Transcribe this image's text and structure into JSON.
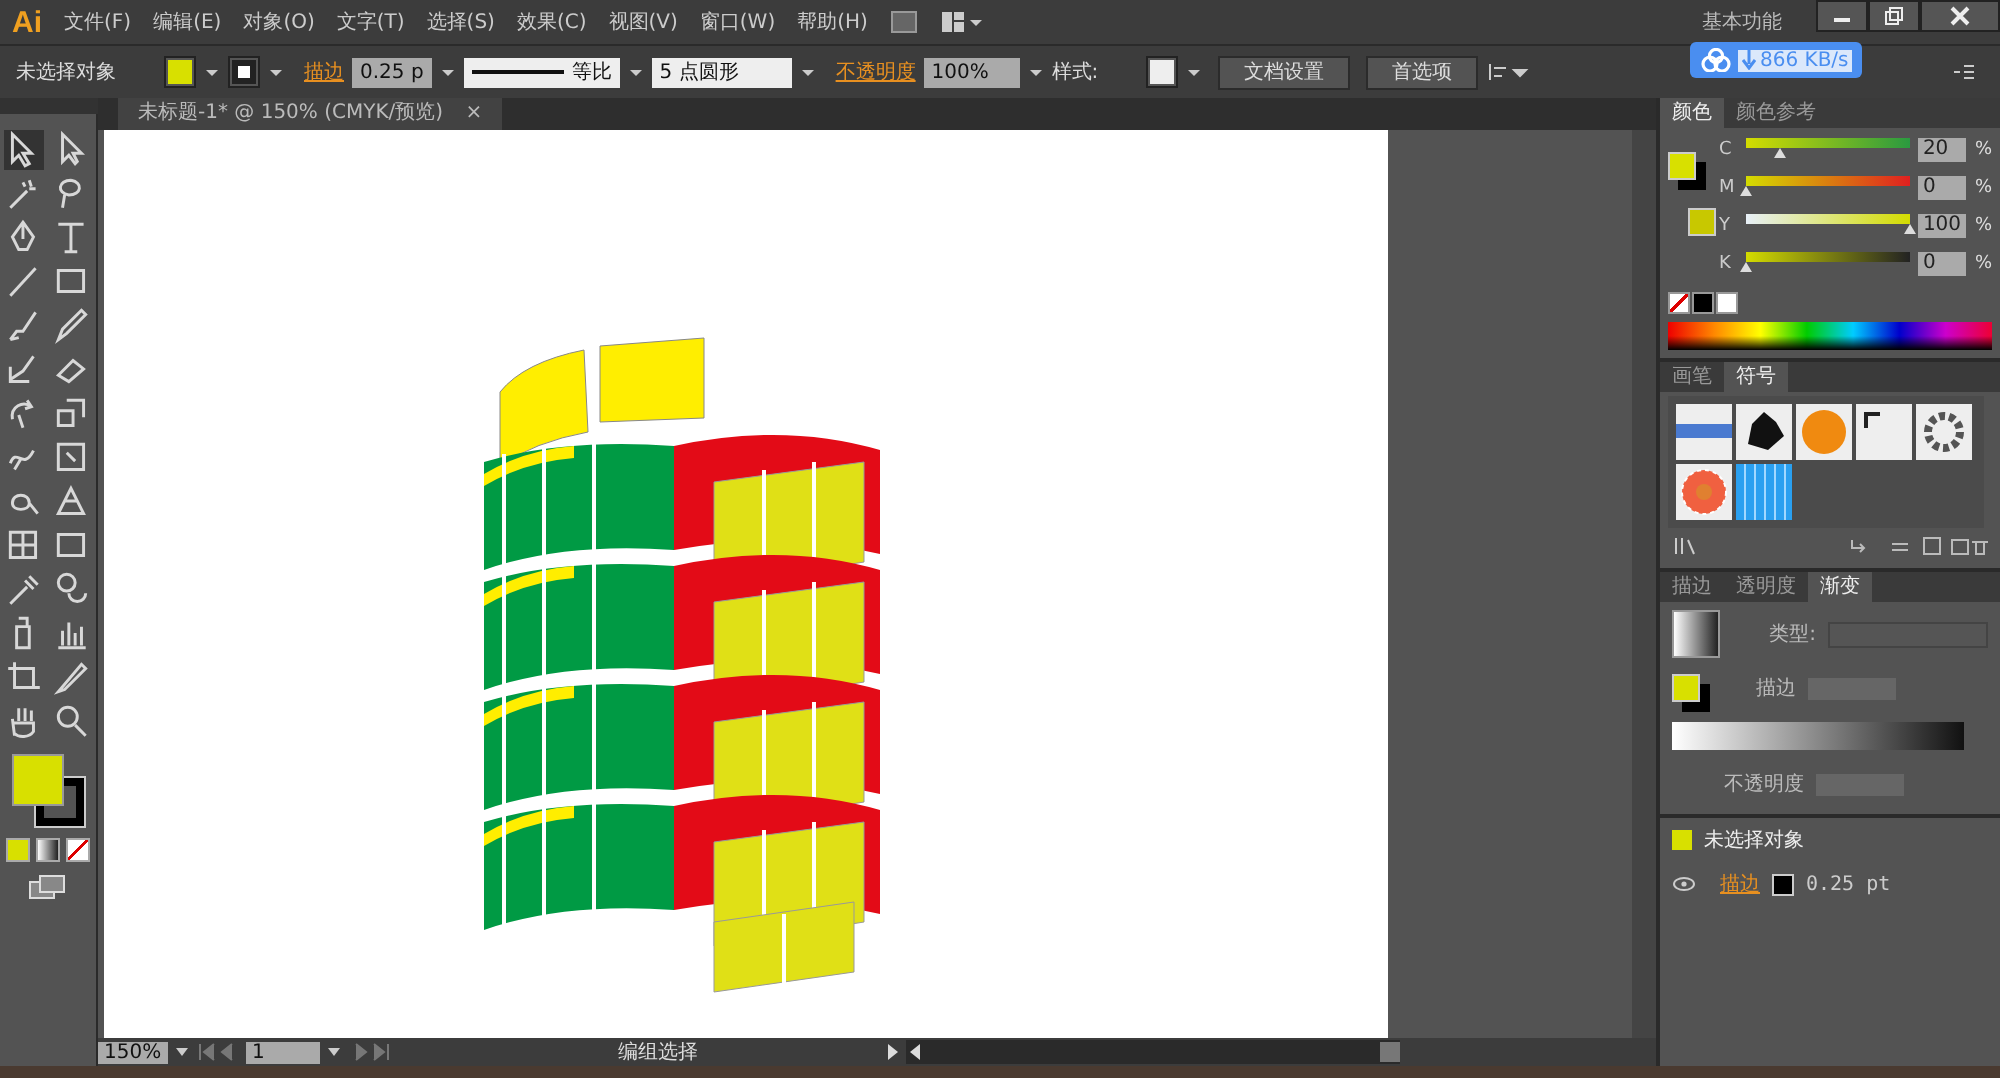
{
  "app_logo": "Ai",
  "menu": [
    "文件(F)",
    "编辑(E)",
    "对象(O)",
    "文字(T)",
    "选择(S)",
    "效果(C)",
    "视图(V)",
    "窗口(W)",
    "帮助(H)"
  ],
  "workspace": "基本功能",
  "transfer_speed": "866 KB/s",
  "control_bar": {
    "selection": "未选择对象",
    "stroke_label": "描边",
    "stroke_weight": "0.25 p",
    "stroke_profile": "等比",
    "brush": "5 点圆形",
    "opacity_label": "不透明度",
    "opacity": "100%",
    "style_label": "样式:",
    "doc_setup": "文档设置",
    "preferences": "首选项"
  },
  "document_tab": {
    "title": "未标题-1* @ 150% (CMYK/预览)",
    "close": "×"
  },
  "color_panel": {
    "tabs": [
      {
        "label": "颜色",
        "selected": true
      },
      {
        "label": "颜色参考",
        "selected": false
      }
    ],
    "sliders": [
      {
        "channel": "C",
        "level": 0.2,
        "value": "20",
        "unit": "%"
      },
      {
        "channel": "M",
        "level": 0,
        "value": "0",
        "unit": "%"
      },
      {
        "channel": "Y",
        "level": 1,
        "value": "100",
        "unit": "%"
      },
      {
        "channel": "K",
        "level": 0,
        "value": "0",
        "unit": "%"
      }
    ]
  },
  "symbols_panel": {
    "tabs": [
      {
        "label": "画笔",
        "selected": false
      },
      {
        "label": "符号",
        "selected": true
      }
    ]
  },
  "gradient_panel": {
    "tabs": [
      {
        "label": "描边",
        "selected": false
      },
      {
        "label": "透明度",
        "selected": false
      },
      {
        "label": "渐变",
        "selected": true
      }
    ],
    "type_label": "类型:",
    "stroke_label": "描边",
    "opacity_label": "不透明度"
  },
  "appearance_panel": {
    "title": "未选择对象",
    "stroke_label": "描边",
    "stroke_value": "0.25 pt"
  },
  "status_bar": {
    "zoom": "150%",
    "artboard": "1",
    "tool": "编组选择"
  }
}
